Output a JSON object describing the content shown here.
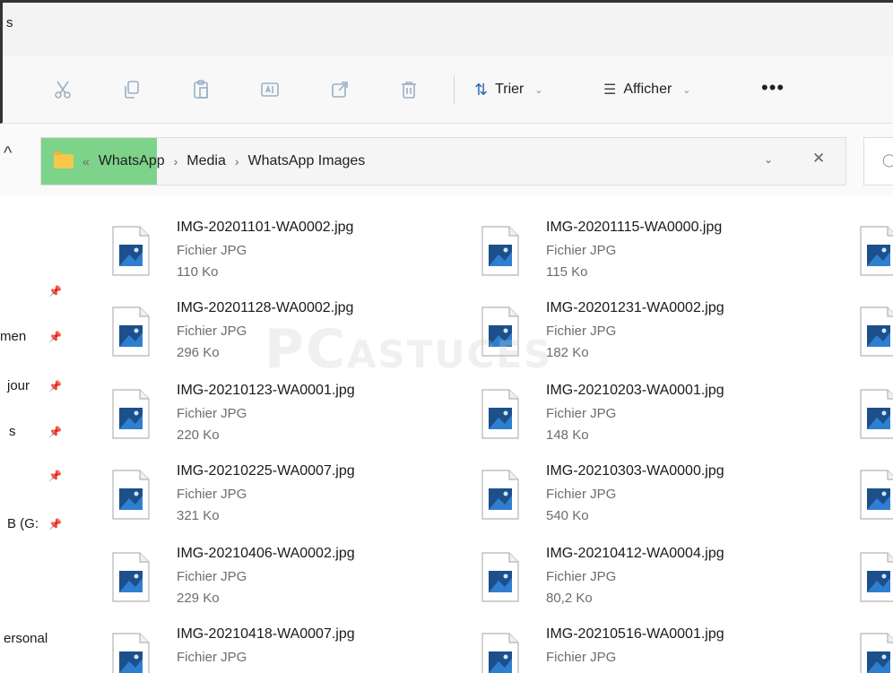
{
  "window": {
    "title_fragment": "s"
  },
  "toolbar": {
    "sort_label": "Trier",
    "view_label": "Afficher",
    "more_label": "•••"
  },
  "address": {
    "segments": [
      "WhatsApp",
      "Media",
      "WhatsApp Images"
    ],
    "overflow_glyph": "«",
    "separator": "›"
  },
  "sidebar": {
    "items": [
      {
        "label": "men",
        "pinned": true
      },
      {
        "label": "jour",
        "pinned": true
      },
      {
        "label": "s",
        "pinned": true
      },
      {
        "label": "",
        "pinned": true
      },
      {
        "label": "B (G:",
        "pinned": true
      },
      {
        "label": "ersonal",
        "pinned": false
      }
    ],
    "pin_glyph": "📌"
  },
  "files": {
    "type_label": "Fichier JPG",
    "items": [
      {
        "name": "IMG-20201101-WA0002.jpg",
        "size": "110 Ko"
      },
      {
        "name": "IMG-20201115-WA0000.jpg",
        "size": "115 Ko"
      },
      {
        "name": "IMG-20201128-WA0002.jpg",
        "size": "296 Ko"
      },
      {
        "name": "IMG-20201231-WA0002.jpg",
        "size": "182 Ko"
      },
      {
        "name": "IMG-20210123-WA0001.jpg",
        "size": "220 Ko"
      },
      {
        "name": "IMG-20210203-WA0001.jpg",
        "size": "148 Ko"
      },
      {
        "name": "IMG-20210225-WA0007.jpg",
        "size": "321 Ko"
      },
      {
        "name": "IMG-20210303-WA0000.jpg",
        "size": "540 Ko"
      },
      {
        "name": "IMG-20210406-WA0002.jpg",
        "size": "229 Ko"
      },
      {
        "name": "IMG-20210412-WA0004.jpg",
        "size": "80,2 Ko"
      },
      {
        "name": "IMG-20210418-WA0007.jpg",
        "size": ""
      },
      {
        "name": "IMG-20210516-WA0001.jpg",
        "size": ""
      }
    ]
  },
  "watermark": {
    "text_big": "PC",
    "text_small": "ASTUCES"
  },
  "colors": {
    "highlight": "#7ed38a",
    "folder": "#f6c84a",
    "image_icon": "#1d4f8a"
  }
}
